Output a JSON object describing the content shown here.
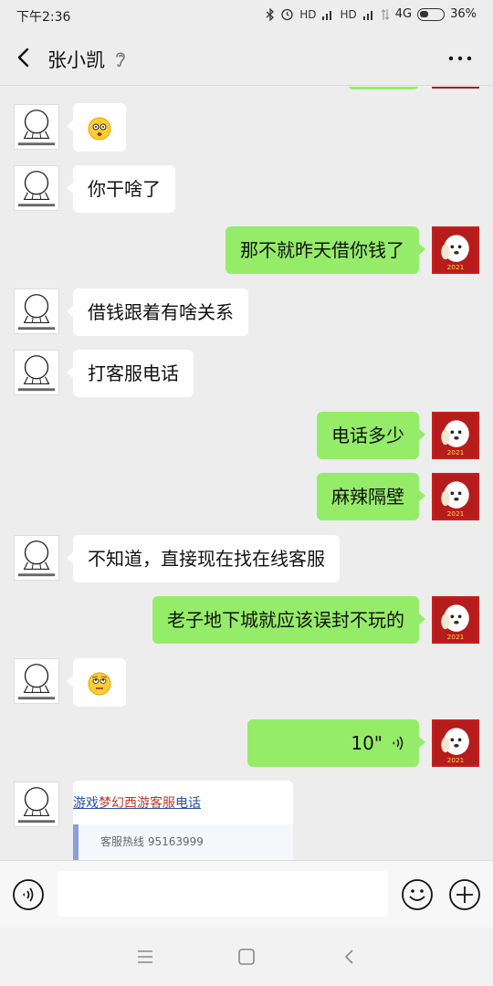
{
  "status_bar": {
    "time": "下午2:36",
    "network": "4G",
    "battery": "36%",
    "hd1": "HD",
    "hd2": "HD"
  },
  "header": {
    "title": "张小凯"
  },
  "messages": [
    {
      "side": "in",
      "type": "emoji",
      "icon": "dizzy-face-emoji"
    },
    {
      "side": "in",
      "type": "text",
      "text": "你干啥了"
    },
    {
      "side": "out",
      "type": "text",
      "text": "那不就昨天借你钱了"
    },
    {
      "side": "in",
      "type": "text",
      "text": "借钱跟着有啥关系"
    },
    {
      "side": "in",
      "type": "text",
      "text": "打客服电话"
    },
    {
      "side": "out",
      "type": "text",
      "text": "电话多少"
    },
    {
      "side": "out",
      "type": "text",
      "text": "麻辣隔壁"
    },
    {
      "side": "in",
      "type": "text",
      "text": "不知道，直接现在找在线客服"
    },
    {
      "side": "out",
      "type": "text",
      "text": "老子地下城就应该误封不玩的"
    },
    {
      "side": "in",
      "type": "emoji",
      "icon": "eye-roll-emoji"
    },
    {
      "side": "out",
      "type": "voice",
      "duration": "10\""
    },
    {
      "side": "in",
      "type": "card"
    }
  ],
  "card": {
    "title_part1": "游戏",
    "title_part2": "梦幻西游客服",
    "title_part3": "电话",
    "hotline": "客服热线  95163999"
  },
  "input": {
    "value": ""
  },
  "avatar_caption": "2021"
}
